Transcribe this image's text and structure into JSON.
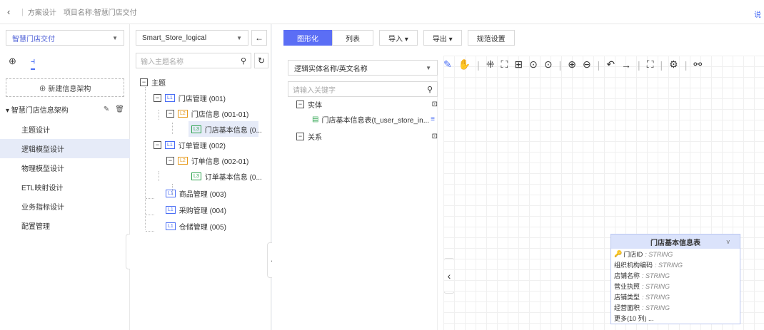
{
  "topbar": {
    "back": "‹",
    "title": "方案设计",
    "project": "项目名称:智慧门店交付",
    "corner": "说"
  },
  "left": {
    "select": "智慧门店交付",
    "new_button": "⊕ 新建信息架构",
    "arch_name": "▾ 智慧门店信息架构",
    "menu": [
      "主题设计",
      "逻辑模型设计",
      "物理模型设计",
      "ETL映射设计",
      "业务指标设计",
      "配置管理"
    ]
  },
  "mid": {
    "select": "Smart_Store_logical",
    "search_placeholder": "输入主题名称",
    "root": "主题",
    "nodes": [
      {
        "level": "L1",
        "label": "门店管理 (001)"
      },
      {
        "level": "L2",
        "label": "门店信息 (001-01)"
      },
      {
        "level": "L3",
        "label": "门店基本信息 (0..."
      },
      {
        "level": "L1",
        "label": "订单管理 (002)"
      },
      {
        "level": "L2",
        "label": "订单信息 (002-01)"
      },
      {
        "level": "L3",
        "label": "订单基本信息 (0..."
      },
      {
        "level": "L1",
        "label": "商品管理 (003)"
      },
      {
        "level": "L1",
        "label": "采购管理 (004)"
      },
      {
        "level": "L1",
        "label": "仓储管理 (005)"
      }
    ]
  },
  "main": {
    "tabs": [
      "图形化",
      "列表"
    ],
    "buttons": [
      "导入 ▾",
      "导出 ▾",
      "规范设置"
    ],
    "entity_select": "逻辑实体名称/英文名称",
    "keyword_placeholder": "请输入关键字",
    "entity_group": "实体",
    "entity_item": "门店基本信息表(t_user_store_in...",
    "relation_group": "关系"
  },
  "card": {
    "title": "门店基本信息表",
    "rows": [
      {
        "name": "门店ID",
        "type": ": STRING"
      },
      {
        "name": "组织机构编码",
        "type": ": STRING"
      },
      {
        "name": "店铺名称",
        "type": ": STRING"
      },
      {
        "name": "营业执照",
        "type": ": STRING"
      },
      {
        "name": "店铺类型",
        "type": ": STRING"
      },
      {
        "name": "经营面积",
        "type": ": STRING"
      }
    ],
    "more": "更多(10 列) ..."
  }
}
